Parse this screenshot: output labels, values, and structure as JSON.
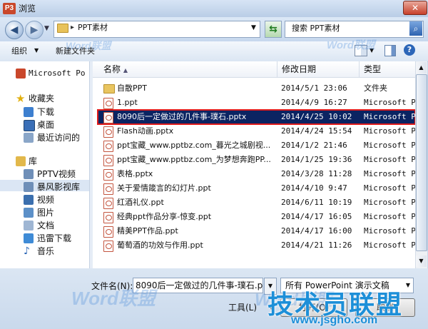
{
  "window": {
    "title": "浏览",
    "app_icon_text": "P3",
    "close_symbol": "✕"
  },
  "address": {
    "path": "PPT素材",
    "separator": "▸"
  },
  "search": {
    "placeholder": "搜索 PPT素材"
  },
  "toolbar": {
    "organize": "组织",
    "new_folder": "新建文件夹"
  },
  "nav": {
    "items": [
      {
        "label": "Microsoft Po",
        "icon": "powerpoint-icon"
      },
      {
        "label": "收藏夹",
        "icon": "star-icon"
      },
      {
        "label": "下载",
        "icon": "download-folder-icon"
      },
      {
        "label": "桌面",
        "icon": "desktop-icon"
      },
      {
        "label": "最近访问的",
        "icon": "recent-icon"
      },
      {
        "label": "库",
        "icon": "library-icon"
      },
      {
        "label": "PPTV视频",
        "icon": "video-library-icon"
      },
      {
        "label": "暴风影视库",
        "icon": "video-library-icon"
      },
      {
        "label": "视频",
        "icon": "video-icon"
      },
      {
        "label": "图片",
        "icon": "pictures-icon"
      },
      {
        "label": "文档",
        "icon": "documents-icon"
      },
      {
        "label": "迅雷下载",
        "icon": "download-icon"
      },
      {
        "label": "音乐",
        "icon": "music-icon"
      }
    ],
    "selected": "桌面"
  },
  "columns": {
    "name": "名称",
    "date": "修改日期",
    "type": "类型"
  },
  "files": [
    {
      "name": "自散PPT",
      "date": "2014/5/1 23:06",
      "type": "文件夹",
      "kind": "folder"
    },
    {
      "name": "1.ppt",
      "date": "2014/4/9 16:27",
      "type": "Microsoft Pov",
      "kind": "ppt"
    },
    {
      "name": "8090后一定做过的几件事-璞石.pptx",
      "date": "2014/4/25 10:02",
      "type": "Microsoft Pov",
      "kind": "ppt",
      "selected": true
    },
    {
      "name": "Flash动画.pptx",
      "date": "2014/4/24 15:54",
      "type": "Microsoft Pov",
      "kind": "ppt"
    },
    {
      "name": "ppt宝藏_www.pptbz.com_暮光之城剧视...",
      "date": "2014/1/2 21:46",
      "type": "Microsoft Pov",
      "kind": "ppt"
    },
    {
      "name": "ppt宝藏_www.pptbz.com_为梦想奔跑PP...",
      "date": "2014/1/25 19:36",
      "type": "Microsoft Pov",
      "kind": "ppt"
    },
    {
      "name": "表格.pptx",
      "date": "2014/3/28 11:28",
      "type": "Microsoft Pov",
      "kind": "ppt"
    },
    {
      "name": "关于爱情箴言的幻灯片.ppt",
      "date": "2014/4/10 9:47",
      "type": "Microsoft Pov",
      "kind": "ppt"
    },
    {
      "name": "红酒礼仪.ppt",
      "date": "2014/6/11 10:19",
      "type": "Microsoft Pov",
      "kind": "ppt"
    },
    {
      "name": "经典ppt作品分享-惊变.ppt",
      "date": "2014/4/17 16:05",
      "type": "Microsoft Pov",
      "kind": "ppt"
    },
    {
      "name": "精美PPT作品.ppt",
      "date": "2014/4/17 16:00",
      "type": "Microsoft Pov",
      "kind": "ppt"
    },
    {
      "name": "葡萄酒的功效与作用.ppt",
      "date": "2014/4/21 11:26",
      "type": "Microsoft Pov",
      "kind": "ppt"
    }
  ],
  "bottom": {
    "filename_label": "文件名(N):",
    "filename_value": "8090后一定做过的几件事-璞石.pptx",
    "filetype_value": "所有 PowerPoint 演示文稿",
    "tools": "工具(L)",
    "open": "打开(O)",
    "cancel": "取消"
  },
  "watermarks": {
    "word": "Word联盟",
    "logo": "技术员联盟",
    "url": "www.jsgho.com"
  },
  "colors": {
    "selected_row": "#0b2462",
    "highlight_box": "#e01b1b",
    "title_bar": "#c9d9ec"
  }
}
